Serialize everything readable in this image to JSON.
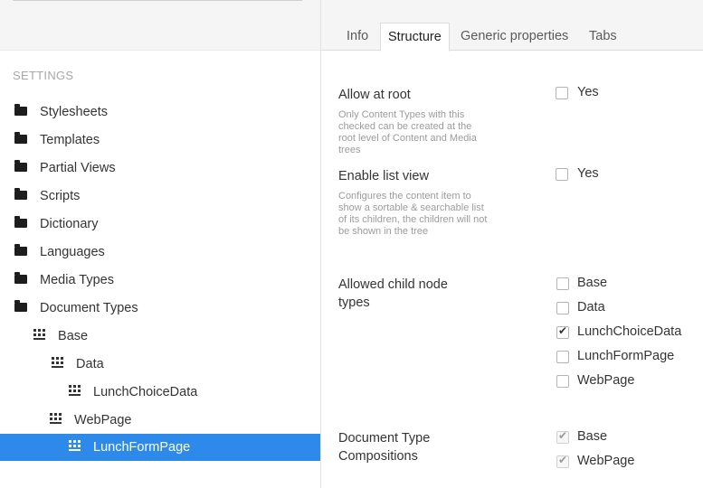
{
  "sidebar": {
    "section_label": "SETTINGS",
    "items": [
      {
        "label": "Stylesheets",
        "icon": "folder-icon"
      },
      {
        "label": "Templates",
        "icon": "folder-icon"
      },
      {
        "label": "Partial Views",
        "icon": "folder-icon"
      },
      {
        "label": "Scripts",
        "icon": "folder-icon"
      },
      {
        "label": "Dictionary",
        "icon": "folder-icon"
      },
      {
        "label": "Languages",
        "icon": "folder-icon"
      },
      {
        "label": "Media Types",
        "icon": "folder-icon"
      },
      {
        "label": "Document Types",
        "icon": "folder-icon"
      },
      {
        "label": "Base",
        "icon": "document-type-icon"
      },
      {
        "label": "Data",
        "icon": "document-type-icon"
      },
      {
        "label": "LunchChoiceData",
        "icon": "document-type-icon"
      },
      {
        "label": "WebPage",
        "icon": "document-type-icon"
      },
      {
        "label": "LunchFormPage",
        "icon": "document-type-icon",
        "selected": true
      }
    ]
  },
  "tabs": [
    {
      "label": "Info"
    },
    {
      "label": "Structure",
      "active": true
    },
    {
      "label": "Generic properties"
    },
    {
      "label": "Tabs"
    }
  ],
  "structure": {
    "allow_at_root": {
      "label": "Allow at root",
      "description": "Only Content Types with this checked can be created at the root level of Content and Media trees",
      "option": "Yes",
      "checked": false
    },
    "enable_list_view": {
      "label": "Enable list view",
      "description": "Configures the content item to show a sortable & searchable list of its children, the children will not be shown in the tree",
      "option": "Yes",
      "checked": false
    },
    "allowed_child_node_types": {
      "label": "Allowed child node types",
      "options": [
        {
          "label": "Base",
          "checked": false
        },
        {
          "label": "Data",
          "checked": false
        },
        {
          "label": "LunchChoiceData",
          "checked": true
        },
        {
          "label": "LunchFormPage",
          "checked": false
        },
        {
          "label": "WebPage",
          "checked": false
        }
      ]
    },
    "compositions": {
      "label": "Document Type Compositions",
      "options": [
        {
          "label": "Base",
          "checked": true,
          "disabled": true
        },
        {
          "label": "WebPage",
          "checked": true,
          "disabled": true
        }
      ]
    }
  },
  "colors": {
    "selected_bg": "#2e8aea",
    "topbar_bg": "#f5f5f5"
  }
}
